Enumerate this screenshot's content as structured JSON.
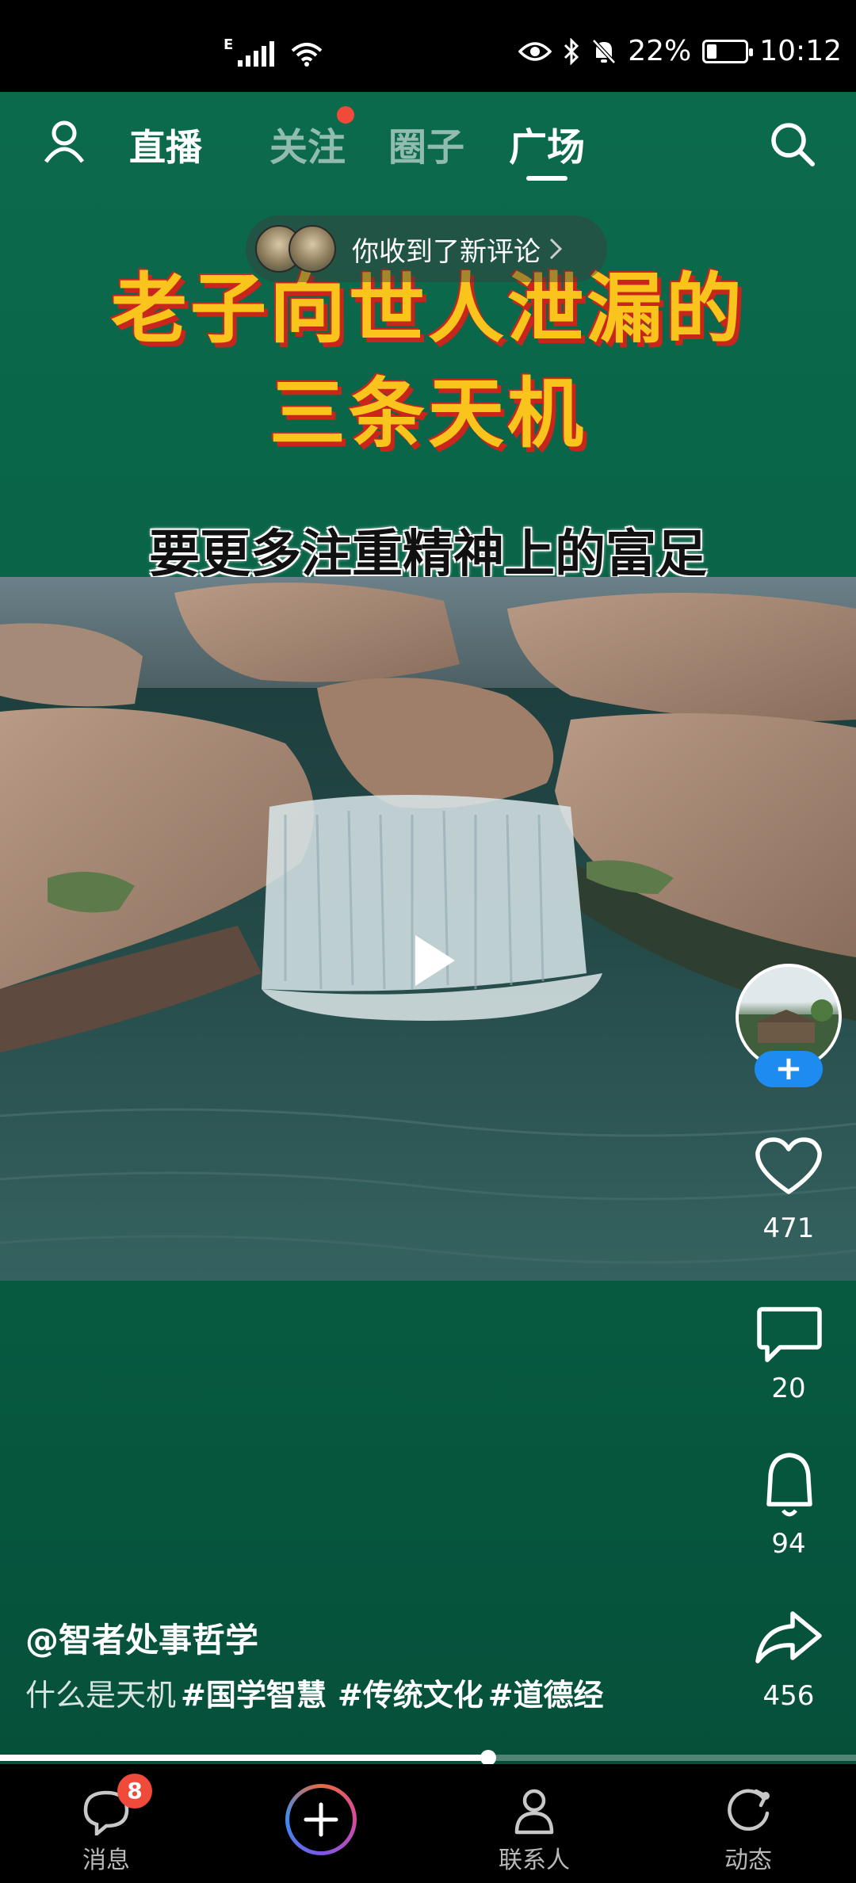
{
  "status_bar": {
    "network_type": "E",
    "battery": "22%",
    "battery_level": 0.22,
    "time": "10:12"
  },
  "top_nav": {
    "live": "直播",
    "tabs": [
      {
        "label": "关注",
        "has_dot": true
      },
      {
        "label": "圈子",
        "has_dot": false
      },
      {
        "label": "广场",
        "active": true
      }
    ]
  },
  "notification": {
    "text": "你收到了新评论"
  },
  "video": {
    "title_line1": "老子向世人泄漏的",
    "title_line2": "三条天机",
    "subtitle": "要更多注重精神上的富足",
    "progress": 0.57
  },
  "actions": {
    "like_count": "471",
    "comment_count": "20",
    "bell_count": "94",
    "share_count": "456",
    "follow_symbol": "+"
  },
  "post": {
    "author": "@智者处事哲学",
    "caption": "什么是天机",
    "hashtags": [
      "#国学智慧",
      "#传统文化",
      "#道德经"
    ]
  },
  "bottom_nav": {
    "messages": "消息",
    "messages_badge": "8",
    "contacts": "联系人",
    "activity": "动态"
  },
  "colors": {
    "background_green": "#0c6a4c",
    "title_yellow": "#f9c51c",
    "title_red_shadow": "#c8261d",
    "badge_red": "#f04a3a",
    "follow_blue": "#1e8bf0"
  }
}
